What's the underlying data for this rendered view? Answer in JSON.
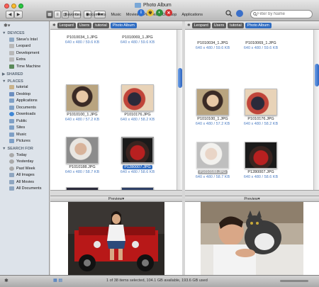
{
  "window": {
    "title": "Photo Album"
  },
  "toolbar": {
    "favorites": [
      "Favorites",
      "Documents",
      "Music",
      "Movies",
      "Pictures",
      "Desktop",
      "Applications"
    ],
    "search_placeholder": "Filter by Name"
  },
  "sidebar": {
    "devices_header": "DEVICES",
    "devices": [
      "Steve's Intel",
      "Leopard",
      "Development",
      "Extra",
      "Time Machine"
    ],
    "shared_header": "SHARED",
    "places_header": "PLACES",
    "places": [
      "tutorial",
      "Desktop",
      "Applications",
      "Documents",
      "Downloads",
      "Public",
      "Sites",
      "Music",
      "Pictures"
    ],
    "search_header": "SEARCH FOR",
    "searches": [
      "Today",
      "Yesterday",
      "Past Week",
      "All Images",
      "All Movies",
      "All Documents"
    ]
  },
  "left_pane": {
    "path": [
      "Leopard",
      "Users",
      "tutorial",
      "Photo Album"
    ],
    "files": [
      {
        "name": "P1010034_1.JPG",
        "size": "640 x 480 / 59.6 KB"
      },
      {
        "name": "P1010069_1.JPG",
        "size": "640 x 480 / 59.6 KB"
      },
      {
        "name": "P1010100_1.JPG",
        "size": "640 x 480 / 57.2 KB"
      },
      {
        "name": "P1010176.JPG",
        "size": "640 x 480 / 58.2 KB"
      },
      {
        "name": "P1010188.JPG",
        "size": "640 x 480 / 58.7 KB"
      },
      {
        "name": "P1280007.JPG",
        "size": "640 x 480 / 58.6 KB"
      }
    ]
  },
  "right_pane": {
    "path": [
      "Leopard",
      "Users",
      "tutorial",
      "Photo Album"
    ],
    "files": [
      {
        "name": "P1010034_1.JPG",
        "size": "640 x 480 / 59.6 KB"
      },
      {
        "name": "P1010069_1.JPG",
        "size": "640 x 480 / 59.6 KB"
      },
      {
        "name": "P1010100_1.JPG",
        "size": "640 x 480 / 57.2 KB"
      },
      {
        "name": "P1010176.JPG",
        "size": "640 x 480 / 58.2 KB"
      },
      {
        "name": "P1010188.JPG",
        "size": "640 x 480 / 58.7 KB"
      },
      {
        "name": "P1280007.JPG",
        "size": "640 x 480 / 58.6 KB"
      }
    ]
  },
  "preview": {
    "left_label": "Preview",
    "right_label": "Preview"
  },
  "status": {
    "text": "1 of 38 items selected, 104.1 GB available, 193.6 GB used"
  },
  "colors": {
    "accent": "#2f6cc1",
    "desktop": "#6b2a4e"
  }
}
